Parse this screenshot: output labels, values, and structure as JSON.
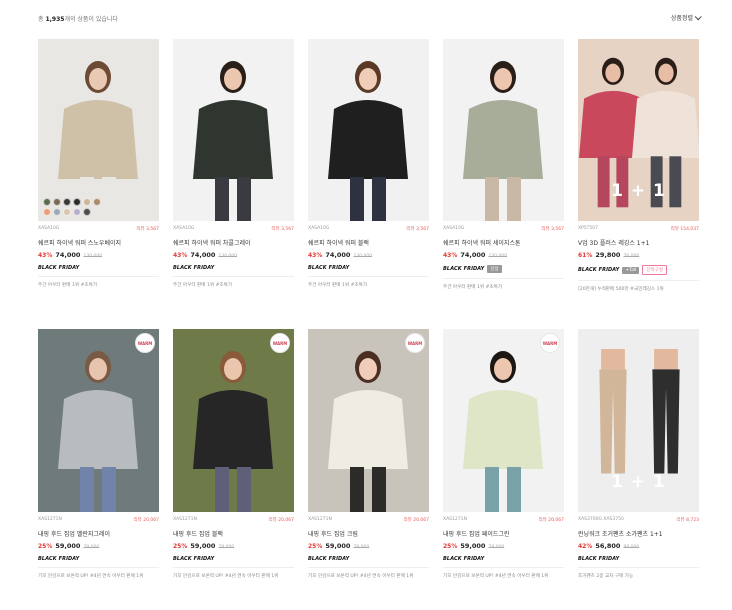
{
  "header": {
    "count_prefix": "총",
    "count_value": "1,935",
    "count_suffix": "개의 상품이 있습니다",
    "sort_label": "상품정렬"
  },
  "products": [
    {
      "code": "XASA10G",
      "reviews": "리뷰 3,567",
      "name": "쉐르피 하이넥 워퍼 스노우베이지",
      "discount": "43%",
      "price": "74,000",
      "original": "130,000",
      "bf": "BLACK FRIDAY",
      "tags": [],
      "desc": "주간 아우터 판매 1위 #초특가",
      "overlay": ""
    },
    {
      "code": "XASA10G",
      "reviews": "리뷰 3,567",
      "name": "쉐르피 하이넥 워퍼 차콜그레이",
      "discount": "43%",
      "price": "74,000",
      "original": "130,000",
      "bf": "BLACK FRIDAY",
      "tags": [],
      "desc": "주간 아우터 판매 1위 #초특가",
      "overlay": ""
    },
    {
      "code": "XASA10G",
      "reviews": "리뷰 3,567",
      "name": "쉐르피 하이넥 워퍼 블랙",
      "discount": "43%",
      "price": "74,000",
      "original": "130,000",
      "bf": "BLACK FRIDAY",
      "tags": [],
      "desc": "주간 아우터 판매 1위 #초특가",
      "overlay": ""
    },
    {
      "code": "XASA10G",
      "reviews": "리뷰 3,567",
      "name": "쉐르피 하이넥 워퍼 세이지스톤",
      "discount": "43%",
      "price": "74,000",
      "original": "130,000",
      "bf": "BLACK FRIDAY",
      "tags": [
        "신상"
      ],
      "desc": "주간 아우터 판매 1위 #초특가",
      "overlay": ""
    },
    {
      "code": "XP5T507",
      "reviews": "리뷰 154,037",
      "name": "V업 3D 플러스 레깅스 1+1",
      "discount": "61%",
      "price": "29,800",
      "original": "76,000",
      "bf": "BLACK FRIDAY",
      "tags": [
        "+Tall",
        "단독구성"
      ],
      "desc": "[20만개] 누적판매 500만 #국민레깅스 1위",
      "overlay": "1 + 1"
    },
    {
      "code": "XAS1271N",
      "reviews": "리뷰 20,067",
      "name": "내핑 후드 집업 멜란지그레이",
      "discount": "25%",
      "price": "59,000",
      "original": "79,000",
      "bf": "BLACK FRIDAY",
      "tags": [],
      "desc": "기모 안감으로 보온력 UP! #4년 연속 아우터 판매 1위",
      "overlay": ""
    },
    {
      "code": "XAS1271N",
      "reviews": "리뷰 20,067",
      "name": "내핑 후드 집업 블랙",
      "discount": "25%",
      "price": "59,000",
      "original": "79,000",
      "bf": "BLACK FRIDAY",
      "tags": [],
      "desc": "기모 안감으로 보온력 UP! #4년 연속 아우터 판매 1위",
      "overlay": ""
    },
    {
      "code": "XAS1271N",
      "reviews": "리뷰 20,067",
      "name": "내핑 후드 집업 크림",
      "discount": "25%",
      "price": "59,000",
      "original": "79,000",
      "bf": "BLACK FRIDAY",
      "tags": [],
      "desc": "기모 안감으로 보온력 UP! #4년 연속 아우터 판매 1위",
      "overlay": ""
    },
    {
      "code": "XAS1271N",
      "reviews": "리뷰 20,067",
      "name": "내핑 후드 집업 페이드그린",
      "discount": "25%",
      "price": "59,000",
      "original": "79,000",
      "bf": "BLACK FRIDAY",
      "tags": [],
      "desc": "기모 안감으로 보온력 UP! #4년 연속 아우터 판매 1위",
      "overlay": ""
    },
    {
      "code": "XAS3700G XAS3750",
      "reviews": "리뷰 8,723",
      "name": "런닝워크 조거팬츠 소가팬츠 1+1",
      "discount": "42%",
      "price": "56,800",
      "original": "98,000",
      "bf": "BLACK FRIDAY",
      "tags": [],
      "desc": "조거팬츠 2종 교차 구매 가능",
      "overlay": "1 + 1"
    }
  ],
  "warm_badge": "WARM",
  "swatch_colors": [
    "#5b6b4e",
    "#7a6a58",
    "#3a3a3a",
    "#2b2b2b",
    "#cdb79b",
    "#a98a6c",
    "#e8a07a",
    "#9fa8b5",
    "#d9c6b0",
    "#b8b0c8",
    "#4d4d4d"
  ],
  "colors": {
    "accent": "#e53935",
    "review": "#e55a5a"
  }
}
